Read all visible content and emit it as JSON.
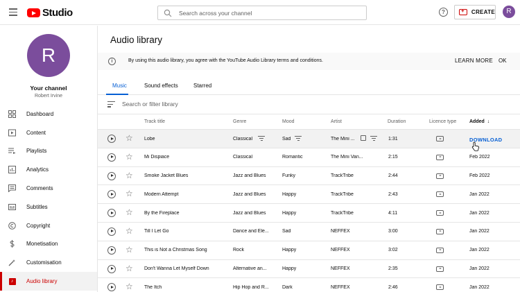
{
  "header": {
    "logo_text": "Studio",
    "search_placeholder": "Search across your channel",
    "help_glyph": "?",
    "create_label": "CREATE",
    "avatar_letter": "R"
  },
  "sidebar": {
    "avatar_letter": "R",
    "channel_title": "Your channel",
    "channel_name": "Robert Irvine",
    "items": [
      {
        "label": "Dashboard",
        "icon": "dashboard-icon"
      },
      {
        "label": "Content",
        "icon": "content-icon"
      },
      {
        "label": "Playlists",
        "icon": "playlists-icon"
      },
      {
        "label": "Analytics",
        "icon": "analytics-icon"
      },
      {
        "label": "Comments",
        "icon": "comments-icon"
      },
      {
        "label": "Subtitles",
        "icon": "subtitles-icon"
      },
      {
        "label": "Copyright",
        "icon": "copyright-icon"
      },
      {
        "label": "Monetisation",
        "icon": "monetisation-icon"
      },
      {
        "label": "Customisation",
        "icon": "customisation-icon"
      },
      {
        "label": "Audio library",
        "icon": "audio-library-icon"
      }
    ],
    "active_item": "Audio library"
  },
  "main": {
    "title": "Audio library",
    "banner": {
      "text": "By using this audio library, you agree with the YouTube Audio Library terms and conditions.",
      "learn_more": "LEARN MORE",
      "ok": "OK"
    },
    "tabs": [
      "Music",
      "Sound effects",
      "Starred"
    ],
    "active_tab": "Music",
    "filter_placeholder": "Search or filter library",
    "columns": {
      "title": "Track title",
      "genre": "Genre",
      "mood": "Mood",
      "artist": "Artist",
      "duration": "Duration",
      "licence": "Licence type",
      "added": "Added",
      "sort_glyph": "↓"
    },
    "download_label": "DOWNLOAD",
    "rows": [
      {
        "title": "Lobe",
        "genre": "Classical",
        "mood": "Sad",
        "artist": "The Mini ...",
        "duration": "1:31",
        "added": "DOWNLOAD"
      },
      {
        "title": "Mi Dispiace",
        "genre": "Classical",
        "mood": "Romantic",
        "artist": "The Mini Van...",
        "duration": "2:15",
        "added": "Feb 2022"
      },
      {
        "title": "Smoke Jacket Blues",
        "genre": "Jazz and Blues",
        "mood": "Funky",
        "artist": "TrackTribe",
        "duration": "2:44",
        "added": "Feb 2022"
      },
      {
        "title": "Modern Attempt",
        "genre": "Jazz and Blues",
        "mood": "Happy",
        "artist": "TrackTribe",
        "duration": "2:43",
        "added": "Jan 2022"
      },
      {
        "title": "By the Fireplace",
        "genre": "Jazz and Blues",
        "mood": "Happy",
        "artist": "TrackTribe",
        "duration": "4:11",
        "added": "Jan 2022"
      },
      {
        "title": "Till I Let Go",
        "genre": "Dance and Ele...",
        "mood": "Sad",
        "artist": "NEFFEX",
        "duration": "3:00",
        "added": "Jan 2022"
      },
      {
        "title": "This is Not a Christmas Song",
        "genre": "Rock",
        "mood": "Happy",
        "artist": "NEFFEX",
        "duration": "3:02",
        "added": "Jan 2022"
      },
      {
        "title": "Don't Wanna Let Myself Down",
        "genre": "Alternative an...",
        "mood": "Happy",
        "artist": "NEFFEX",
        "duration": "2:35",
        "added": "Jan 2022"
      },
      {
        "title": "The Itch",
        "genre": "Hip Hop and R...",
        "mood": "Dark",
        "artist": "NEFFEX",
        "duration": "2:46",
        "added": "Jan 2022"
      }
    ]
  },
  "colors": {
    "accent_red": "#cc0000",
    "link_blue": "#065fd4",
    "avatar_purple": "#7b4d9c"
  }
}
